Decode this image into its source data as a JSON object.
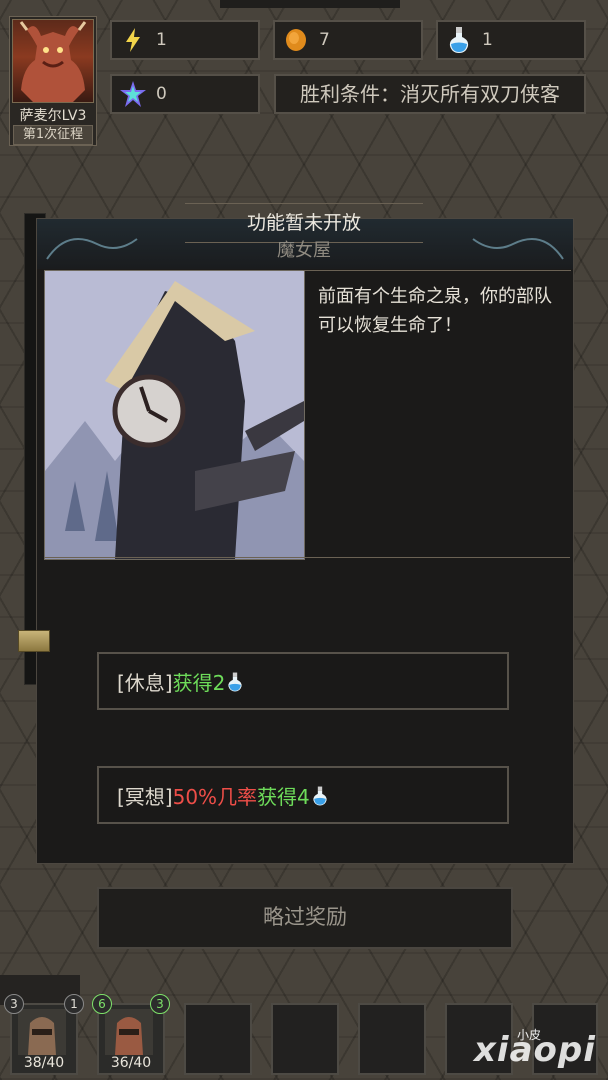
{
  "hero": {
    "name": "萨麦尔LV3",
    "expedition": "第1次征程"
  },
  "resources": [
    {
      "icon": "lightning-icon",
      "value": "1"
    },
    {
      "icon": "gold-coin-icon",
      "value": "7"
    },
    {
      "icon": "potion-icon",
      "value": "1"
    },
    {
      "icon": "crystal-star-icon",
      "value": "0"
    }
  ],
  "victory_condition": "胜利条件：消灭所有双刀侠客",
  "dialog": {
    "banner": "功能暂未开放",
    "title": "魔女屋",
    "description": "前面有个生命之泉，你的部队可以恢复生命了！",
    "options": [
      {
        "prefix": "[休息]",
        "gain": "获得2",
        "icon": "potion-icon"
      },
      {
        "prefix": "[冥想]",
        "chance": "50%几率",
        "gain": "获得4",
        "icon": "potion-icon"
      }
    ],
    "skip_label": "略过奖励"
  },
  "units": [
    {
      "hp": "38/40",
      "level": "3"
    },
    {
      "hp": "36/40",
      "level": "6",
      "badge_extra": "1",
      "badge_extra2": "3"
    }
  ],
  "watermark": {
    "main": "xiaopi",
    "small": "小皮"
  },
  "colors": {
    "gain": "#6edc5a",
    "chance": "#ee4e48",
    "panel": "#1b1a19"
  }
}
